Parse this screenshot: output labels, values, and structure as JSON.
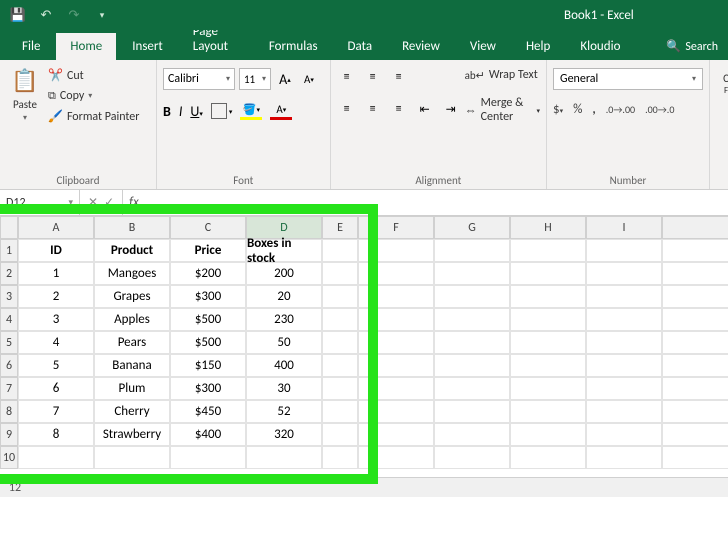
{
  "app": {
    "title": "Book1 - Excel"
  },
  "qat": {
    "save": "💾",
    "undo": "↶",
    "redo": "↷",
    "custom": "▾"
  },
  "tabs": [
    "File",
    "Home",
    "Insert",
    "Page Layout",
    "Formulas",
    "Data",
    "Review",
    "View",
    "Help",
    "Kloudio"
  ],
  "active_tab": "Home",
  "search_label": "Search",
  "ribbon": {
    "clipboard": {
      "paste": "Paste",
      "cut": "Cut",
      "copy": "Copy",
      "format_painter": "Format Painter",
      "label": "Clipboard"
    },
    "font": {
      "name": "Calibri",
      "size": "11",
      "label": "Font"
    },
    "alignment": {
      "wrap": "Wrap Text",
      "merge": "Merge & Center",
      "label": "Alignment"
    },
    "number": {
      "format": "General",
      "label": "Number"
    }
  },
  "namebox": "D12",
  "columns": [
    "A",
    "B",
    "C",
    "D",
    "E",
    "F",
    "G",
    "H",
    "I"
  ],
  "rows": [
    "1",
    "2",
    "3",
    "4",
    "5",
    "6",
    "7",
    "8",
    "9",
    "10"
  ],
  "extra_rows": [
    "12"
  ],
  "headers": [
    "ID",
    "Product",
    "Price",
    "Boxes in stock"
  ],
  "data": [
    [
      "1",
      "Mangoes",
      "$200",
      "200"
    ],
    [
      "2",
      "Grapes",
      "$300",
      "20"
    ],
    [
      "3",
      "Apples",
      "$500",
      "230"
    ],
    [
      "4",
      "Pears",
      "$500",
      "50"
    ],
    [
      "5",
      "Banana",
      "$150",
      "400"
    ],
    [
      "6",
      "Plum",
      "$300",
      "30"
    ],
    [
      "7",
      "Cherry",
      "$450",
      "52"
    ],
    [
      "8",
      "Strawberry",
      "$400",
      "320"
    ]
  ],
  "selected_cell": "D12",
  "chart_data": {
    "type": "table",
    "columns": [
      "ID",
      "Product",
      "Price",
      "Boxes in stock"
    ],
    "rows": [
      [
        1,
        "Mangoes",
        200,
        200
      ],
      [
        2,
        "Grapes",
        300,
        20
      ],
      [
        3,
        "Apples",
        500,
        230
      ],
      [
        4,
        "Pears",
        500,
        50
      ],
      [
        5,
        "Banana",
        150,
        400
      ],
      [
        6,
        "Plum",
        300,
        30
      ],
      [
        7,
        "Cherry",
        450,
        52
      ],
      [
        8,
        "Strawberry",
        400,
        320
      ]
    ]
  }
}
